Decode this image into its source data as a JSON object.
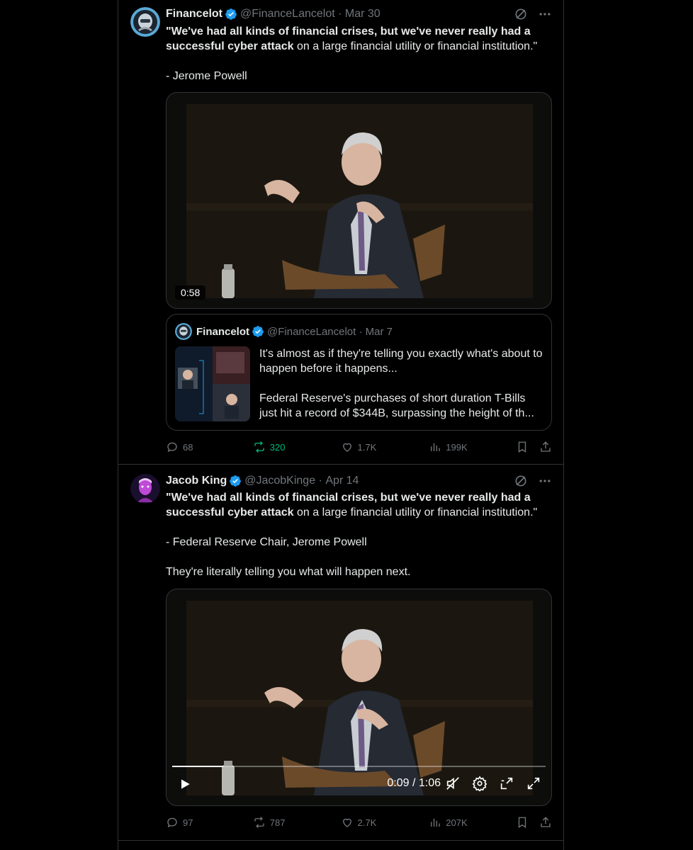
{
  "colors": {
    "background": "#000000",
    "accent": "#1d9bf0",
    "repost_green": "#00ba7c",
    "muted": "#71767b"
  },
  "tweets": [
    {
      "author": {
        "name": "Financelot",
        "handle": "@FinanceLancelot",
        "date": "Mar 30"
      },
      "text": {
        "bold": "\"We've had all kinds of financial crises, but we've never really had a successful cyber attack",
        "rest": " on a large financial utility or financial institution.\"",
        "attribution": "- Jerome Powell"
      },
      "video": {
        "duration": "0:58"
      },
      "quote": {
        "author": {
          "name": "Financelot",
          "handle": "@FinanceLancelot",
          "date": "Mar 7"
        },
        "line1": "It's almost as if they're telling you exactly what's about to happen before it happens...",
        "line2": "Federal Reserve's purchases of short duration T-Bills just hit a record of $344B, surpassing the height of th..."
      },
      "stats": {
        "replies": "68",
        "reposts": "320",
        "likes": "1.7K",
        "views": "199K"
      }
    },
    {
      "author": {
        "name": "Jacob King",
        "handle": "@JacobKinge",
        "date": "Apr 14"
      },
      "text": {
        "bold": "\"We've had all kinds of financial crises, but we've never really had a successful cyber attack",
        "rest": " on a large financial utility or financial institution.\"",
        "attribution": "- Federal Reserve Chair, Jerome Powell",
        "extra": "They're literally telling you what will happen next."
      },
      "video": {
        "time": "0:09 / 1:06",
        "progress": 0.136
      },
      "stats": {
        "replies": "97",
        "reposts": "787",
        "likes": "2.7K",
        "views": "207K"
      }
    }
  ],
  "icons": [
    "grok-icon",
    "more-icon",
    "reply-icon",
    "repost-icon",
    "like-icon",
    "views-icon",
    "bookmark-icon",
    "share-icon",
    "play-icon",
    "mute-icon",
    "settings-icon",
    "pip-icon",
    "fullscreen-icon"
  ]
}
